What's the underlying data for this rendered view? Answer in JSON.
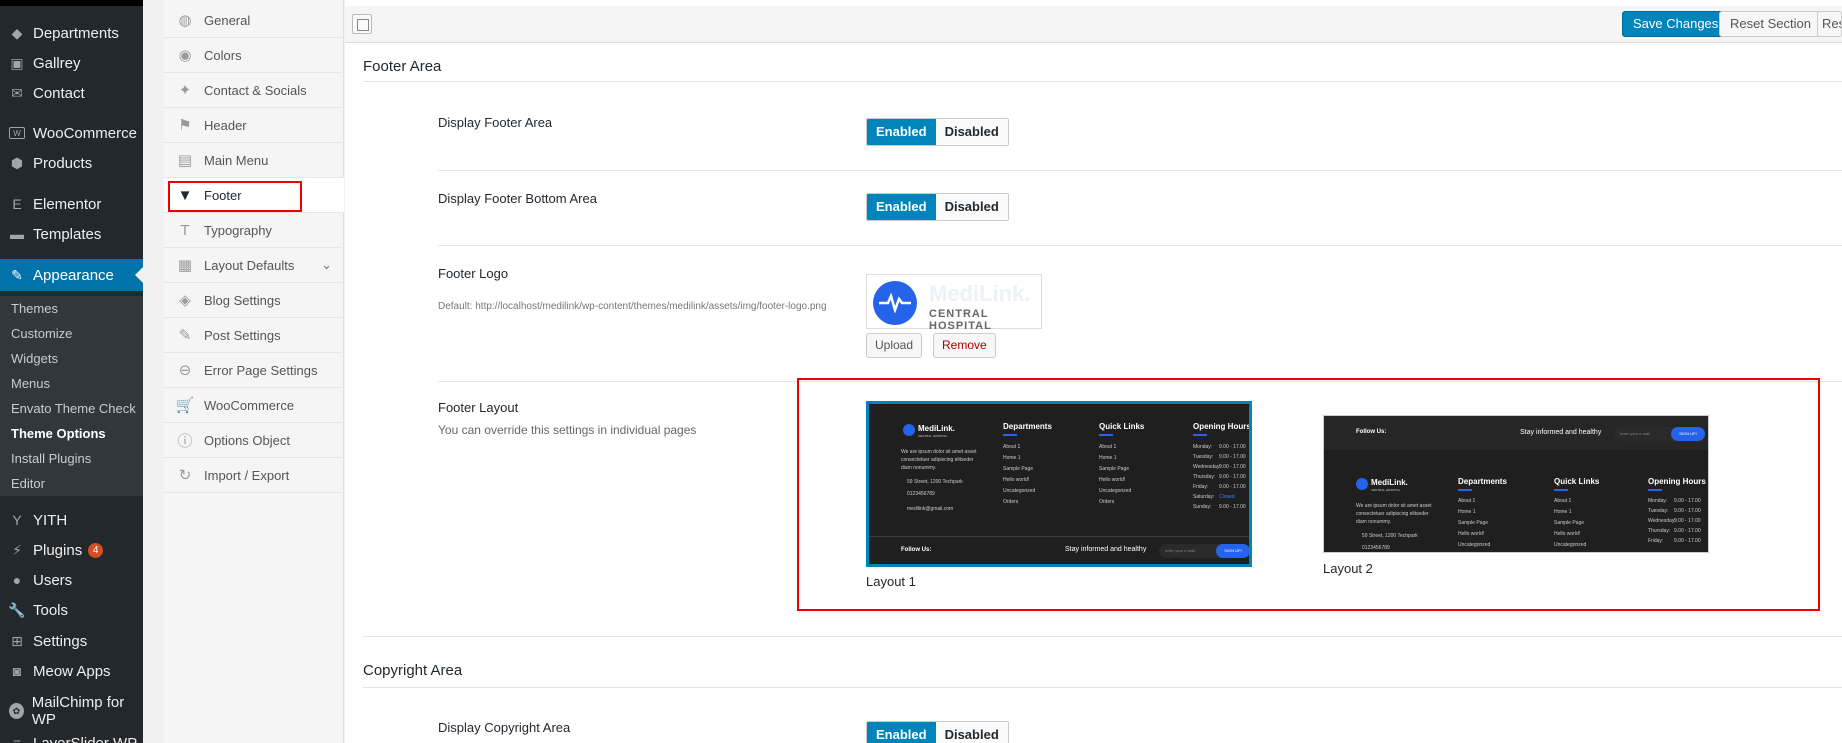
{
  "wp_menu": {
    "items": [
      {
        "label": "Departments",
        "icon": "tag-icon"
      },
      {
        "label": "Gallrey",
        "icon": "gallery-icon"
      },
      {
        "label": "Contact",
        "icon": "mail-icon"
      },
      {
        "label": "WooCommerce",
        "icon": "woo-icon"
      },
      {
        "label": "Products",
        "icon": "box-icon"
      },
      {
        "label": "Elementor",
        "icon": "elementor-icon"
      },
      {
        "label": "Templates",
        "icon": "folder-icon"
      },
      {
        "label": "Appearance",
        "icon": "brush-icon"
      },
      {
        "label": "YITH",
        "icon": "yith-icon"
      },
      {
        "label": "Plugins",
        "icon": "plugin-icon",
        "badge": "4"
      },
      {
        "label": "Users",
        "icon": "user-icon"
      },
      {
        "label": "Tools",
        "icon": "wrench-icon"
      },
      {
        "label": "Settings",
        "icon": "settings-icon"
      },
      {
        "label": "Meow Apps",
        "icon": "camera-icon"
      },
      {
        "label": "MailChimp for WP",
        "icon": "mailchimp-icon"
      },
      {
        "label": "LayerSlider WP",
        "icon": "layers-icon"
      }
    ],
    "appearance_sub": [
      "Themes",
      "Customize",
      "Widgets",
      "Menus",
      "Envato Theme Check",
      "Theme Options",
      "Install Plugins",
      "Editor"
    ]
  },
  "options_nav": [
    {
      "label": "General",
      "icon": "globe-icon"
    },
    {
      "label": "Colors",
      "icon": "eye-icon"
    },
    {
      "label": "Contact & Socials",
      "icon": "twitter-icon"
    },
    {
      "label": "Header",
      "icon": "flag-icon"
    },
    {
      "label": "Main Menu",
      "icon": "book-icon"
    },
    {
      "label": "Footer",
      "icon": "triangle-down-icon"
    },
    {
      "label": "Typography",
      "icon": "text-icon"
    },
    {
      "label": "Layout Defaults",
      "icon": "grid-icon"
    },
    {
      "label": "Blog Settings",
      "icon": "tags-icon"
    },
    {
      "label": "Post Settings",
      "icon": "edit-icon"
    },
    {
      "label": "Error Page Settings",
      "icon": "minus-circle-icon"
    },
    {
      "label": "WooCommerce",
      "icon": "cart-icon"
    },
    {
      "label": "Options Object",
      "icon": "info-icon"
    },
    {
      "label": "Import / Export",
      "icon": "refresh-icon"
    }
  ],
  "toolbar": {
    "save": "Save Changes",
    "reset_section": "Reset Section",
    "reset_all": "Reset All"
  },
  "footer_area": {
    "title": "Footer Area",
    "display_footer_area": {
      "label": "Display Footer Area",
      "on": "Enabled",
      "off": "Disabled"
    },
    "display_footer_bottom": {
      "label": "Display Footer Bottom Area",
      "on": "Enabled",
      "off": "Disabled"
    },
    "footer_logo": {
      "label": "Footer Logo",
      "default": "Default: http://localhost/medilink/wp-content/themes/medilink/assets/img/footer-logo.png",
      "logo_name": "MediLink.",
      "logo_sub": "CENTRAL HOSPITAL",
      "upload": "Upload",
      "remove": "Remove"
    },
    "footer_layout": {
      "label": "Footer Layout",
      "desc": "You can override this settings in individual pages",
      "layout1": "Layout 1",
      "layout2": "Layout 2"
    }
  },
  "preview": {
    "brand": "MediLink.",
    "brand_sub": "CENTRAL HOSPITAL",
    "about": "We are ipsum dolor sit amet asset consectetuer adipiscing elitseder diam nonummy.",
    "address": "59 Street, 1200 Techpark",
    "phone": "0123456789",
    "email": "medilink@gmail.com",
    "col_departments": "Departments",
    "col_quick": "Quick Links",
    "col_hours": "Opening Hours",
    "links": [
      "About 1",
      "Home 1",
      "Sample Page",
      "Hello world!",
      "Uncategorized",
      "Orders"
    ],
    "days": [
      "Monday:",
      "Tuesday:",
      "Wednesday:",
      "Thursday:",
      "Friday:",
      "Saturday:",
      "Sunday:"
    ],
    "hours": [
      "9.00 - 17.00",
      "9.00 - 17.00",
      "9.00 - 17.00",
      "9.00 - 17.00",
      "9.00 - 17.00",
      "Closed",
      "9.00 - 17.00"
    ],
    "follow": "Follow Us:",
    "stay": "Stay informed and healthy",
    "email_placeholder": "enter your e-mail",
    "signup": "SIGN UP!"
  },
  "copyright_area": {
    "title": "Copyright Area",
    "display_copyright": {
      "label": "Display Copyright Area",
      "on": "Enabled",
      "off": "Disabled"
    }
  }
}
